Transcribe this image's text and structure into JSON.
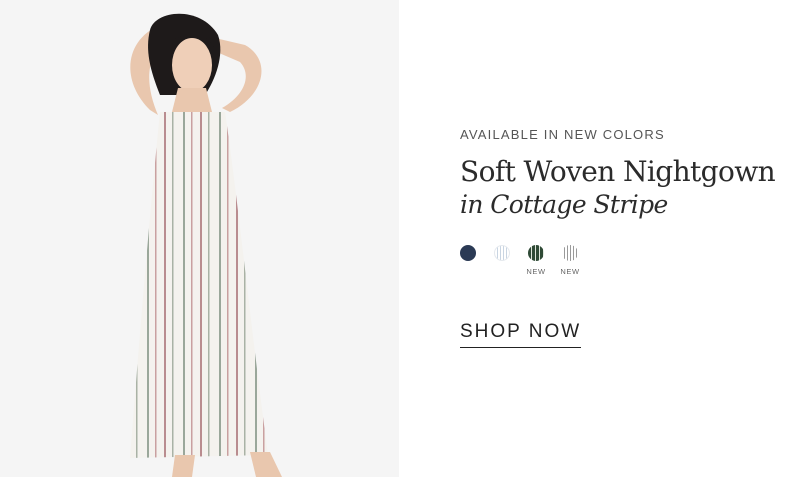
{
  "hero": {
    "image": "model-in-striped-nightgown",
    "background": "#f5f5f5"
  },
  "promo": {
    "eyebrow": "AVAILABLE IN NEW COLORS",
    "title": "Soft Woven Nightgown",
    "subtitle": "in Cottage Stripe",
    "cta": "SHOP NOW"
  },
  "swatches": [
    {
      "name": "navy",
      "color": "#2b3a55",
      "tag": ""
    },
    {
      "name": "light-blue-stripe",
      "color": "#dfe6ee",
      "tag": ""
    },
    {
      "name": "green-stripe",
      "color": "#2f4a36",
      "tag": "NEW"
    },
    {
      "name": "grey-stripe",
      "color": "#d9d9d9",
      "tag": "NEW"
    }
  ]
}
